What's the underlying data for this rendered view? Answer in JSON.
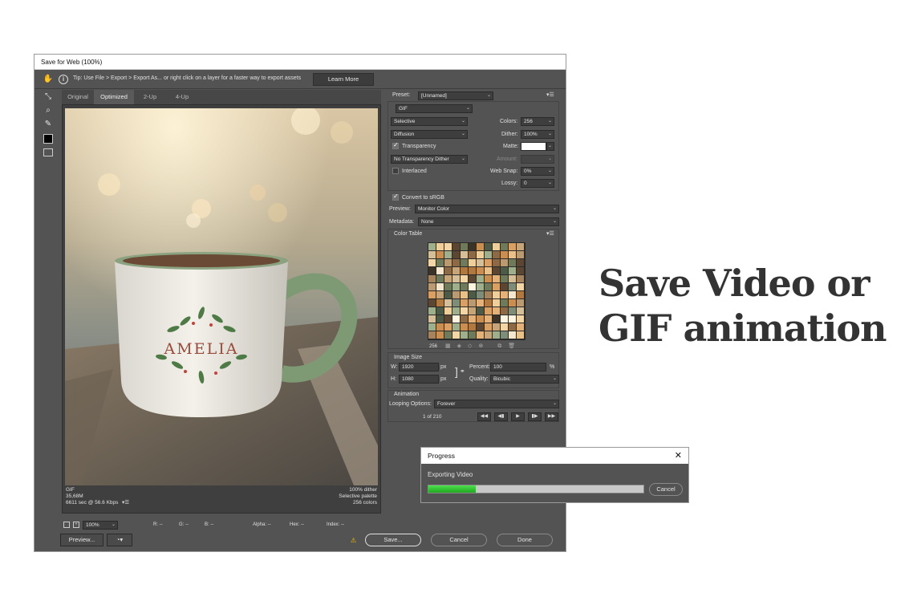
{
  "window": {
    "title": "Save for Web (100%)"
  },
  "tip": {
    "text": "Tip: Use File > Export > Export As...  or right click on a layer for a faster way to export assets",
    "learn_more": "Learn More"
  },
  "tabs": [
    {
      "label": "Original",
      "active": false
    },
    {
      "label": "Optimized",
      "active": true
    },
    {
      "label": "2-Up",
      "active": false
    },
    {
      "label": "4-Up",
      "active": false
    }
  ],
  "preview_image": {
    "mug_text": "AMELIA"
  },
  "image_info": {
    "left": [
      "GIF",
      "35,68M",
      "6611 sec @ 56.6 Kbps"
    ],
    "right": [
      "100% dither",
      "Selective palette",
      "256 colors"
    ]
  },
  "settings": {
    "preset_label": "Preset:",
    "preset_value": "[Unnamed]",
    "format": "GIF",
    "reduction": "Selective",
    "dither_algo": "Diffusion",
    "colors_label": "Colors:",
    "colors_value": "256",
    "dither_label": "Dither:",
    "dither_value": "100%",
    "transparency_label": "Transparency",
    "transparency_checked": true,
    "matte_label": "Matte:",
    "trans_dither": "No Transparency Dither",
    "amount_label": "Amount:",
    "interlaced_label": "Interlaced",
    "interlaced_checked": false,
    "websnap_label": "Web Snap:",
    "websnap_value": "0%",
    "lossy_label": "Lossy:",
    "lossy_value": "0",
    "convert_label": "Convert to sRGB",
    "convert_checked": true,
    "preview_label": "Preview:",
    "preview_value": "Monitor Color",
    "metadata_label": "Metadata:",
    "metadata_value": "None"
  },
  "color_table": {
    "title": "Color Table",
    "count": "256"
  },
  "image_size": {
    "title": "Image Size",
    "w_label": "W:",
    "w_value": "1920",
    "w_unit": "px",
    "h_label": "H:",
    "h_value": "1080",
    "h_unit": "px",
    "percent_label": "Percent:",
    "percent_value": "100",
    "percent_unit": "%",
    "quality_label": "Quality:",
    "quality_value": "Bicubic"
  },
  "animation": {
    "title": "Animation",
    "looping_label": "Looping Options:",
    "looping_value": "Forever",
    "frame_counter": "1 of 210"
  },
  "statusbar": {
    "zoom": "100%",
    "r": "R: --",
    "g": "G: --",
    "b": "B: --",
    "alpha": "Alpha: --",
    "hex": "Hex: --",
    "index": "Index: --"
  },
  "buttons": {
    "preview": "Preview...",
    "save": "Save...",
    "cancel": "Cancel",
    "done": "Done"
  },
  "progress": {
    "title": "Progress",
    "status": "Exporting Video",
    "cancel": "Cancel",
    "fraction": 0.22
  },
  "headline": {
    "line1": "Save Video or",
    "line2": "GIF animation"
  },
  "colors": {
    "ui_bg": "#535353",
    "progress_green": "#2fc02f",
    "headline": "#333333"
  }
}
